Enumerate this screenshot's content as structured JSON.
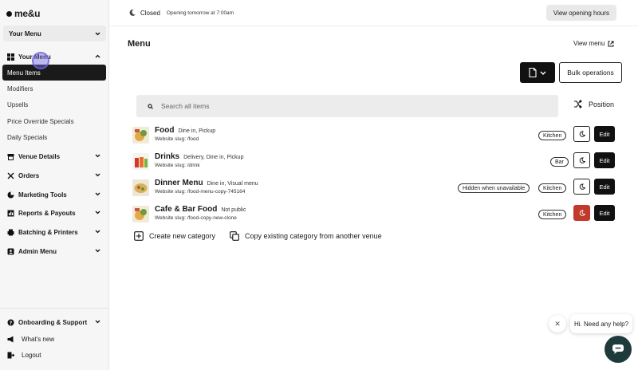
{
  "brand": {
    "logo_text": "me&u"
  },
  "sidebar": {
    "venue_select": "Your Menu",
    "groups": [
      {
        "label": "Your Menu",
        "icon": "grid-icon"
      },
      {
        "label": "Venue Details",
        "icon": "storefront-icon"
      },
      {
        "label": "Orders",
        "icon": "cutlery-icon"
      },
      {
        "label": "Marketing Tools",
        "icon": "pie-chart-icon"
      },
      {
        "label": "Reports & Payouts",
        "icon": "chart-icon"
      },
      {
        "label": "Batching & Printers",
        "icon": "printer-icon"
      },
      {
        "label": "Admin Menu",
        "icon": "admin-icon"
      }
    ],
    "sub_items": [
      "Menu Items",
      "Modifiers",
      "Upsells",
      "Price Override Specials",
      "Daily Specials"
    ],
    "bottom": [
      {
        "label": "Onboarding & Support",
        "icon": "help-icon"
      },
      {
        "label": "What's new",
        "icon": "megaphone-icon"
      },
      {
        "label": "Logout",
        "icon": "logout-icon"
      }
    ]
  },
  "topbar": {
    "status": "Closed",
    "opening_text": "Opening tomorrow at 7:00am",
    "hours_button": "View opening hours"
  },
  "main": {
    "title": "Menu",
    "view_menu": "View menu",
    "bulk_button": "Bulk operations",
    "search_placeholder": "Search all items",
    "position_label": "Position",
    "edit_label": "Edit",
    "categories": [
      {
        "name": "Food",
        "tags": "Dine in, Pickup",
        "slug": "Website slug: /food",
        "pills": [
          "Kitchen"
        ],
        "moon_state": "default"
      },
      {
        "name": "Drinks",
        "tags": "Delivery, Dine in, Pickup",
        "slug": "Website slug: /drink",
        "pills": [
          "Bar"
        ],
        "moon_state": "default"
      },
      {
        "name": "Dinner Menu",
        "tags": "Dine in, Visual menu",
        "slug": "Website slug: /food-menu-copy-745164",
        "pills": [
          "Hidden when unavailable",
          "Kitchen"
        ],
        "moon_state": "default"
      },
      {
        "name": "Cafe & Bar Food",
        "tags": "Not public",
        "slug": "Website slug: /food-copy-new-clone",
        "pills": [
          "Kitchen"
        ],
        "moon_state": "active-red"
      }
    ],
    "create_category": "Create new category",
    "copy_category": "Copy existing category from another venue"
  },
  "help": {
    "bubble_text": "Hi. Need any help?"
  },
  "colors": {
    "accent": "#111111",
    "moon_active": "#c23a2b",
    "chat": "#1f3a3b"
  }
}
